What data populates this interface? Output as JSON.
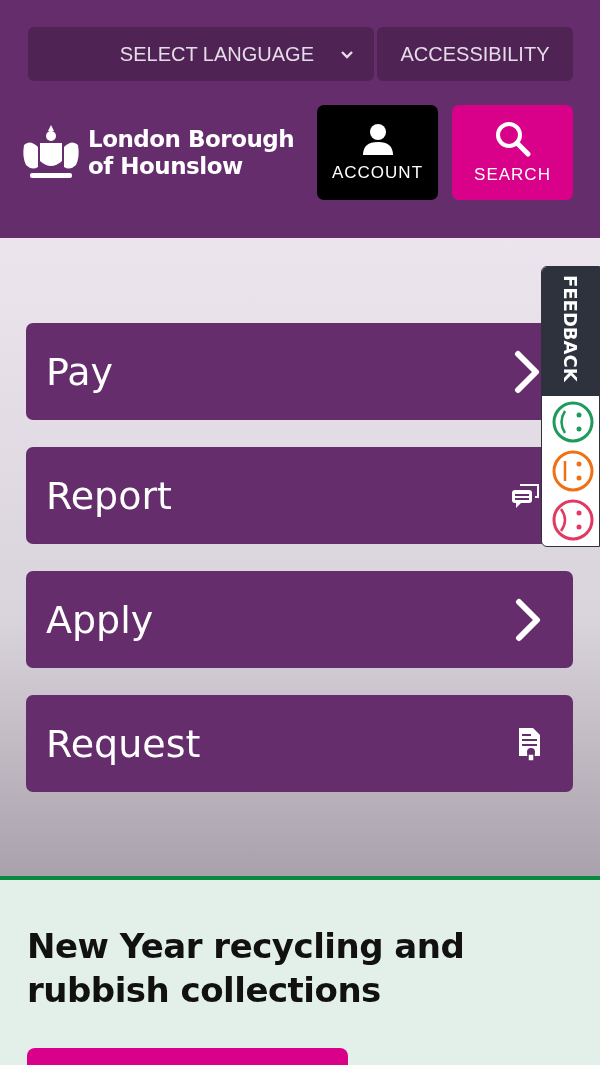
{
  "header": {
    "language_select": "SELECT LANGUAGE",
    "accessibility": "ACCESSIBILITY",
    "logo_text": [
      "London Borough",
      "of Hounslow"
    ],
    "account": "ACCOUNT",
    "search": "SEARCH"
  },
  "menu": [
    {
      "label": "Pay",
      "kind": "chevron"
    },
    {
      "label": "Report",
      "kind": "chat"
    },
    {
      "label": "Apply",
      "kind": "chevron"
    },
    {
      "label": "Request",
      "kind": "document"
    }
  ],
  "feedback": {
    "label": "FEEDBACK"
  },
  "news": {
    "heading": "New Year recycling and rubbish collections"
  }
}
